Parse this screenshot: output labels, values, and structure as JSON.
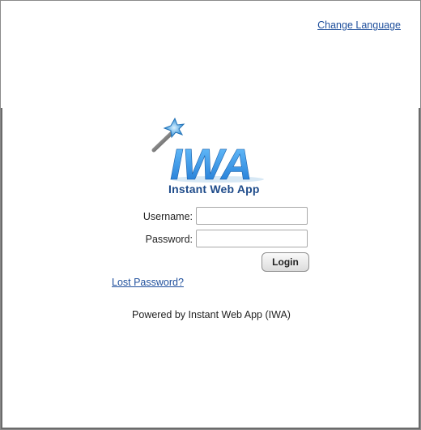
{
  "header": {
    "change_language_label": "Change Language"
  },
  "logo": {
    "wordmark": "IWA",
    "subtitle": "Instant Web App",
    "brand_color": "#2b95e8",
    "dark_color": "#1e4b8a"
  },
  "login_form": {
    "username_label": "Username:",
    "username_value": "",
    "password_label": "Password:",
    "password_value": "",
    "login_button_label": "Login"
  },
  "links": {
    "lost_password_label": "Lost Password?"
  },
  "footer": {
    "powered_by": "Powered by Instant Web App (IWA)"
  }
}
